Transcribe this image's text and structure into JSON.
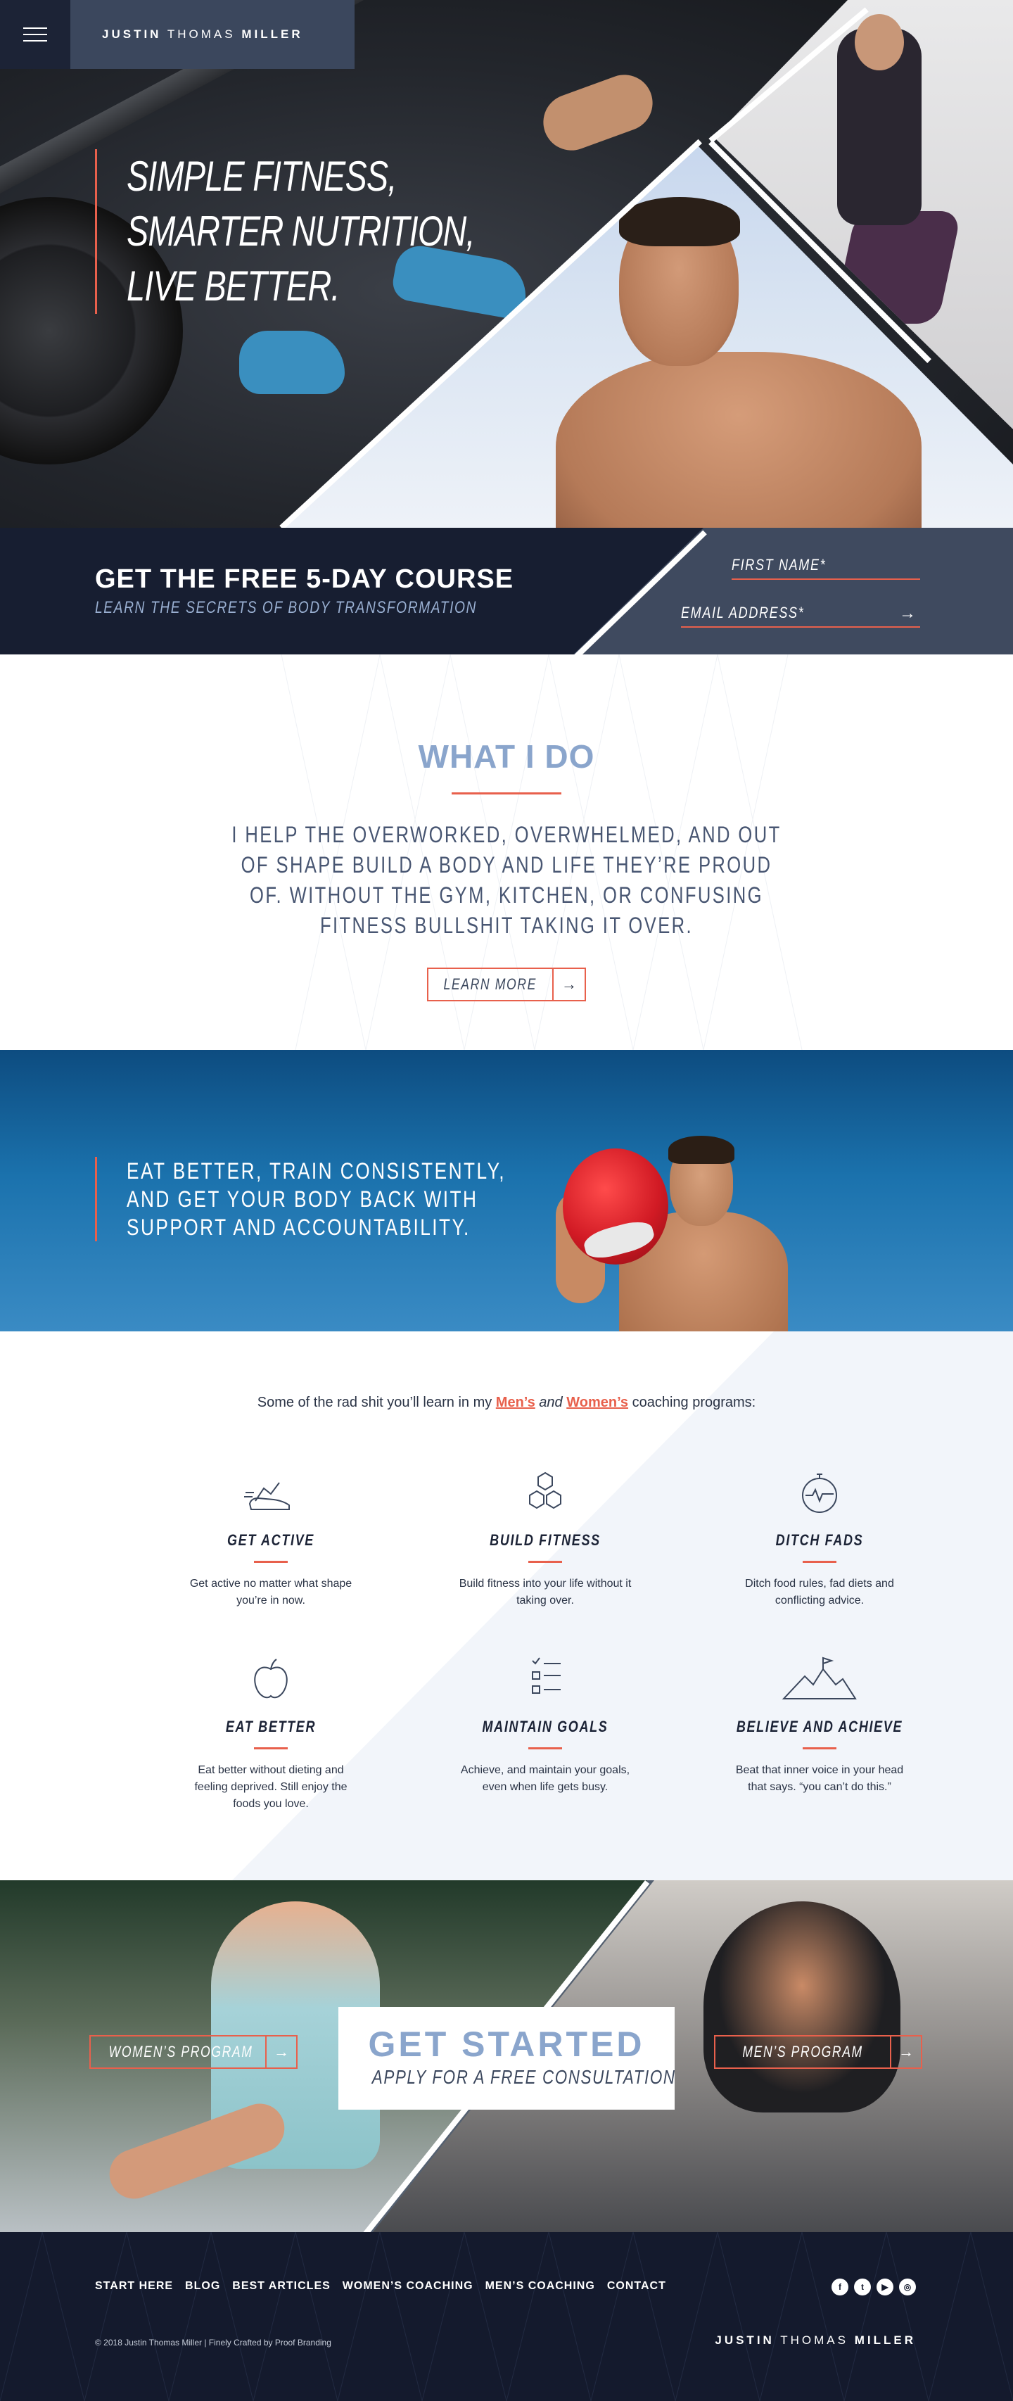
{
  "brand": {
    "first": "JUSTIN",
    "middle": "THOMAS",
    "last": "MILLER"
  },
  "hero": {
    "lines": [
      "SIMPLE FITNESS,",
      "SMARTER NUTRITION,",
      "LIVE BETTER."
    ]
  },
  "course": {
    "title": "GET THE FREE 5-DAY COURSE",
    "subtitle": "LEARN THE SECRETS OF BODY TRANSFORMATION",
    "first_name_placeholder": "FIRST NAME*",
    "email_placeholder": "EMAIL ADDRESS*"
  },
  "what": {
    "title": "WHAT I DO",
    "body": "I HELP THE OVERWORKED, OVERWHELMED, AND OUT OF SHAPE BUILD A BODY AND LIFE THEY’RE PROUD OF. WITHOUT THE GYM, KITCHEN, OR CONFUSING FITNESS BULLSHIT TAKING IT OVER.",
    "button": "LEARN MORE"
  },
  "blue": {
    "lines": [
      "EAT BETTER, TRAIN CONSISTENTLY,",
      "AND GET YOUR BODY BACK WITH",
      "SUPPORT AND ACCOUNTABILITY."
    ]
  },
  "programs": {
    "intro_start": "Some of the rad shit you’ll learn in my ",
    "mens": "Men’s",
    "and": " and ",
    "womens": "Women’s",
    "intro_end": " coaching programs:",
    "features": [
      {
        "icon": "shoe-icon",
        "title": "GET ACTIVE",
        "text": "Get active no matter what shape you’re in now."
      },
      {
        "icon": "cubes-icon",
        "title": "BUILD FITNESS",
        "text": "Build fitness into your life without it taking over."
      },
      {
        "icon": "stopwatch-icon",
        "title": "DITCH FADS",
        "text": "Ditch food rules, fad diets and conflicting advice."
      },
      {
        "icon": "apple-icon",
        "title": "EAT BETTER",
        "text": "Eat better without dieting and feeling deprived. Still enjoy the foods you love."
      },
      {
        "icon": "checklist-icon",
        "title": "MAINTAIN GOALS",
        "text": "Achieve, and maintain your goals, even when life gets busy."
      },
      {
        "icon": "mountain-flag-icon",
        "title": "BELIEVE AND ACHIEVE",
        "text": "Beat that inner voice in your head that says. “you can’t do this.”"
      }
    ]
  },
  "start": {
    "womens": "WOMEN’S PROGRAM",
    "mens": "MEN’S PROGRAM",
    "title": "GET STARTED",
    "subtitle": "APPLY FOR A FREE CONSULTATION"
  },
  "footer": {
    "nav": [
      "START HERE",
      "BLOG",
      "BEST ARTICLES",
      "WOMEN’S COACHING",
      "MEN’S COACHING",
      "CONTACT"
    ],
    "copyright": "© 2018 Justin Thomas Miller  |  Finely Crafted by Proof Branding",
    "social": [
      {
        "icon": "facebook-icon",
        "glyph": "f"
      },
      {
        "icon": "twitter-icon",
        "glyph": "t"
      },
      {
        "icon": "youtube-icon",
        "glyph": "▶"
      },
      {
        "icon": "instagram-icon",
        "glyph": "◎"
      }
    ]
  },
  "colors": {
    "accent": "#e8604c",
    "navy": "#171e31",
    "slate": "#3f4a5f",
    "light_blue": "#8aa5cc"
  }
}
